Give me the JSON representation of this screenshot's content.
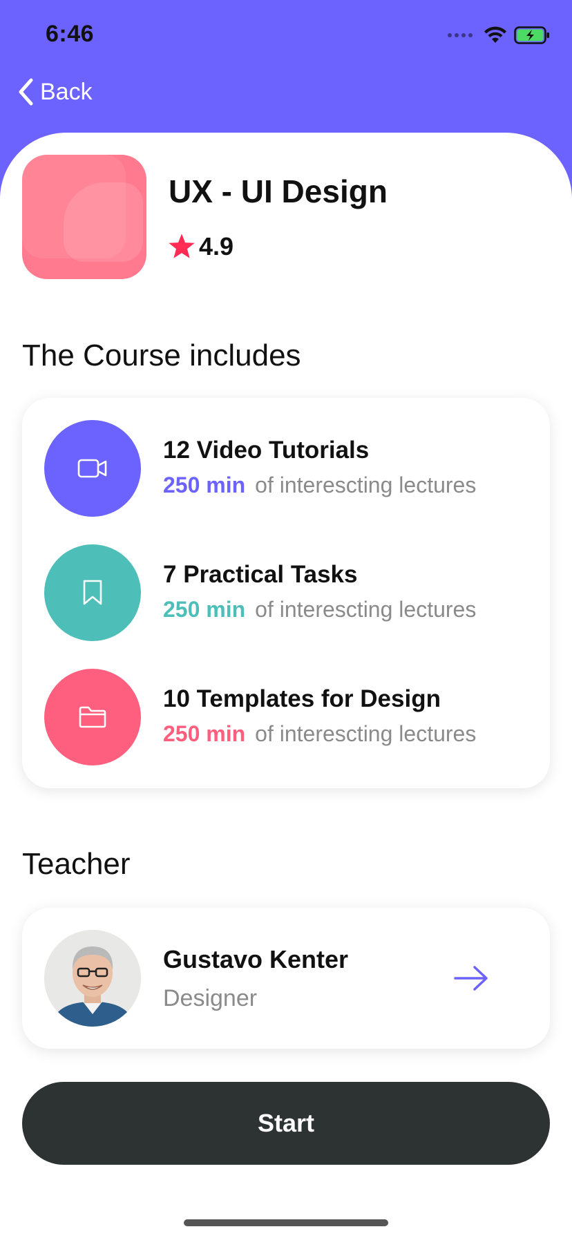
{
  "status_bar": {
    "time": "6:46"
  },
  "nav": {
    "back_label": "Back"
  },
  "course": {
    "title": "UX - UI Design",
    "rating": "4.9",
    "thumbnail_color": "#ff7a8e"
  },
  "includes": {
    "heading": "The Course includes",
    "items": [
      {
        "title": "12 Video Tutorials",
        "minutes": "250 min",
        "description": "of interescting lectures",
        "icon": "video-camera-icon",
        "color": "#6c63ff"
      },
      {
        "title": "7 Practical Tasks",
        "minutes": "250 min",
        "description": "of interescting lectures",
        "icon": "bookmark-icon",
        "color": "#4dbfb8"
      },
      {
        "title": "10 Templates for Design",
        "minutes": "250 min",
        "description": "of interescting lectures",
        "icon": "folder-icon",
        "color": "#ff5f7e"
      }
    ]
  },
  "teacher": {
    "heading": "Teacher",
    "name": "Gustavo Kenter",
    "role": "Designer"
  },
  "actions": {
    "start_label": "Start"
  },
  "colors": {
    "header_bg": "#6c63ff",
    "accent_purple": "#6c63ff",
    "accent_teal": "#4dbfb8",
    "accent_pink": "#ff5f7e",
    "star": "#ff2d55",
    "start_button_bg": "#2d3233"
  }
}
